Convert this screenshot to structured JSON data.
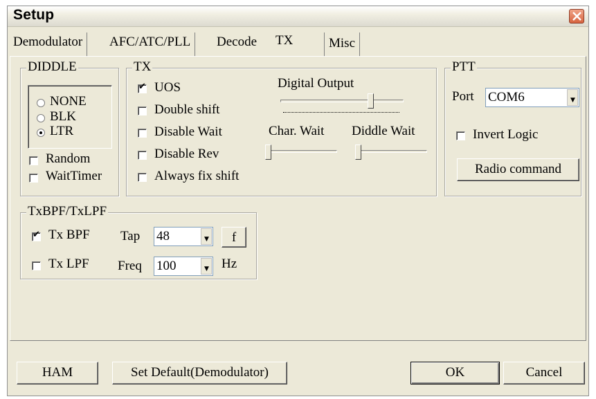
{
  "window": {
    "title": "Setup"
  },
  "tabs": [
    "Demodulator",
    "AFC/ATC/PLL",
    "Decode",
    "TX",
    "Misc"
  ],
  "active_tab": "TX",
  "diddle": {
    "label": "DIDDLE",
    "options": [
      "NONE",
      "BLK",
      "LTR"
    ],
    "selected": "LTR",
    "random_label": "Random",
    "random_checked": false,
    "waittimer_label": "WaitTimer",
    "waittimer_checked": false
  },
  "tx": {
    "label": "TX",
    "uos_label": "UOS",
    "uos_checked": true,
    "double_shift_label": "Double shift",
    "double_shift_checked": false,
    "disable_wait_label": "Disable Wait",
    "disable_wait_checked": false,
    "disable_rev_label": "Disable Rev",
    "disable_rev_checked": false,
    "always_fix_shift_label": "Always fix shift",
    "always_fix_shift_checked": false,
    "digital_output_label": "Digital Output",
    "digital_output_level": 0.75,
    "char_wait_label": "Char. Wait",
    "char_wait_level": 0.0,
    "diddle_wait_label": "Diddle Wait",
    "diddle_wait_level": 0.0
  },
  "ptt": {
    "label": "PTT",
    "port_label": "Port",
    "port_value": "COM6",
    "invert_logic_label": "Invert Logic",
    "invert_logic_checked": false,
    "radio_command_label": "Radio command"
  },
  "bpf": {
    "label": "TxBPF/TxLPF",
    "txbpf_label": "Tx BPF",
    "txbpf_checked": true,
    "tap_label": "Tap",
    "tap_value": "48",
    "f_button_label": "f",
    "txlpf_label": "Tx LPF",
    "txlpf_checked": false,
    "freq_label": "Freq",
    "freq_value": "100",
    "freq_unit": "Hz"
  },
  "buttons": {
    "ham": "HAM",
    "set_default": "Set Default(Demodulator)",
    "ok": "OK",
    "cancel": "Cancel"
  }
}
